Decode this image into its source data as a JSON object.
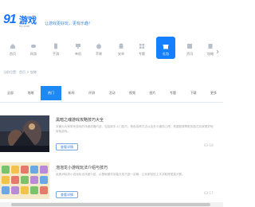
{
  "header": {
    "logo_mark": "91",
    "logo_cn": "游戏",
    "logo_sub": "91.com",
    "slogan": "让游戏更好玩，更有乐趣！"
  },
  "nav": {
    "items": [
      {
        "label": "首页",
        "icon": "home-icon"
      },
      {
        "label": "网游",
        "icon": "gamepad-icon"
      },
      {
        "label": "手游",
        "icon": "phone-icon"
      },
      {
        "label": "单机",
        "icon": "monitor-icon"
      },
      {
        "label": "苹果",
        "icon": "apple-icon"
      },
      {
        "label": "安卓",
        "icon": "android-icon"
      },
      {
        "label": "专题",
        "icon": "grid-icon"
      },
      {
        "label": "礼包",
        "icon": "gift-icon"
      },
      {
        "label": "资讯",
        "icon": "news-icon"
      },
      {
        "label": "攻略",
        "icon": "book-icon"
      }
    ],
    "active_index": 7
  },
  "breadcrumb": "当前位置：首页 > 攻略",
  "tabs": {
    "items": [
      "全部",
      "攻略",
      "热门",
      "新闻",
      "评测",
      "活动",
      "视频",
      "图片",
      "专题",
      "下载",
      "更多"
    ],
    "active_index": 2
  },
  "articles": [
    {
      "title": "黑暗之魂游戏攻略技巧大全",
      "desc": "本篇为大家带来游戏的详细攻略内容，包括新手入门技巧、角色培养方法以及关卡通关心得，希望能够帮助到各位玩家更好地体验游戏。",
      "button": "查看详情",
      "date": "03-18"
    },
    {
      "title": "泡泡龙小游戏玩法介绍与技巧",
      "desc": "经典消除类小游戏玩法详细介绍，从基础操作到高分技巧逐一讲解，让玩家轻松上手并取得更高分数。",
      "button": "查看详情",
      "date": "03-17"
    }
  ],
  "colors": {
    "accent": "#1480ff",
    "tab_active": "#1e88f5"
  }
}
